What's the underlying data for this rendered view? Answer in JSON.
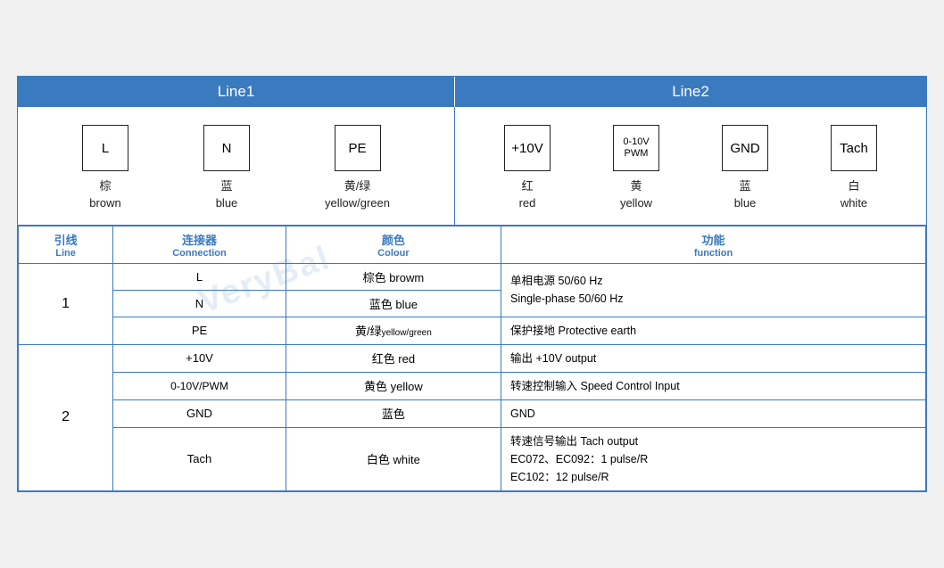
{
  "header": {
    "line1_label": "Line1",
    "line2_label": "Line2"
  },
  "diagram": {
    "line1": [
      {
        "symbol": "L",
        "zh": "棕",
        "en": "brown"
      },
      {
        "symbol": "N",
        "zh": "蓝",
        "en": "blue"
      },
      {
        "symbol": "PE",
        "zh": "黄/绿",
        "en": "yellow/green"
      }
    ],
    "line2": [
      {
        "symbol": "+10V",
        "zh": "红",
        "en": "red"
      },
      {
        "symbol": "0-10V\nPWM",
        "zh": "黄",
        "en": "yellow"
      },
      {
        "symbol": "GND",
        "zh": "蓝",
        "en": "blue"
      },
      {
        "symbol": "Tach",
        "zh": "白",
        "en": "white"
      }
    ]
  },
  "table": {
    "headers": {
      "line": {
        "zh": "引线",
        "en": "Line"
      },
      "connection": {
        "zh": "连接器",
        "en": "Connection"
      },
      "colour": {
        "zh": "颜色",
        "en": "Colour"
      },
      "function": {
        "zh": "功能",
        "en": "function"
      }
    },
    "rows": [
      {
        "line_num": "1",
        "rowspan": 3,
        "entries": [
          {
            "connection": "L",
            "colour_zh": "棕色",
            "colour_en": "browm",
            "function": "单相电源 50/60 Hz\nSingle-phase 50/60 Hz"
          },
          {
            "connection": "N",
            "colour_zh": "蓝色",
            "colour_en": "blue",
            "function": ""
          },
          {
            "connection": "PE",
            "colour_zh": "黄/绿",
            "colour_en_small": "yellow/green",
            "function": "保护接地 Protective earth"
          }
        ]
      },
      {
        "line_num": "2",
        "rowspan": 4,
        "entries": [
          {
            "connection": "+10V",
            "colour_zh": "红色",
            "colour_en": "red",
            "function": "输出 +10V output"
          },
          {
            "connection": "0-10V/PWM",
            "colour_zh": "黄色",
            "colour_en": "yellow",
            "function": "转速控制输入 Speed Control Input"
          },
          {
            "connection": "GND",
            "colour_zh": "蓝色",
            "colour_en": "",
            "function": "GND"
          },
          {
            "connection": "Tach",
            "colour_zh": "白色",
            "colour_en": "white",
            "function": "转速信号输出 Tach output\nEC072、EC092：1 pulse/R\nEC102：12 pulse/R"
          }
        ]
      }
    ]
  }
}
